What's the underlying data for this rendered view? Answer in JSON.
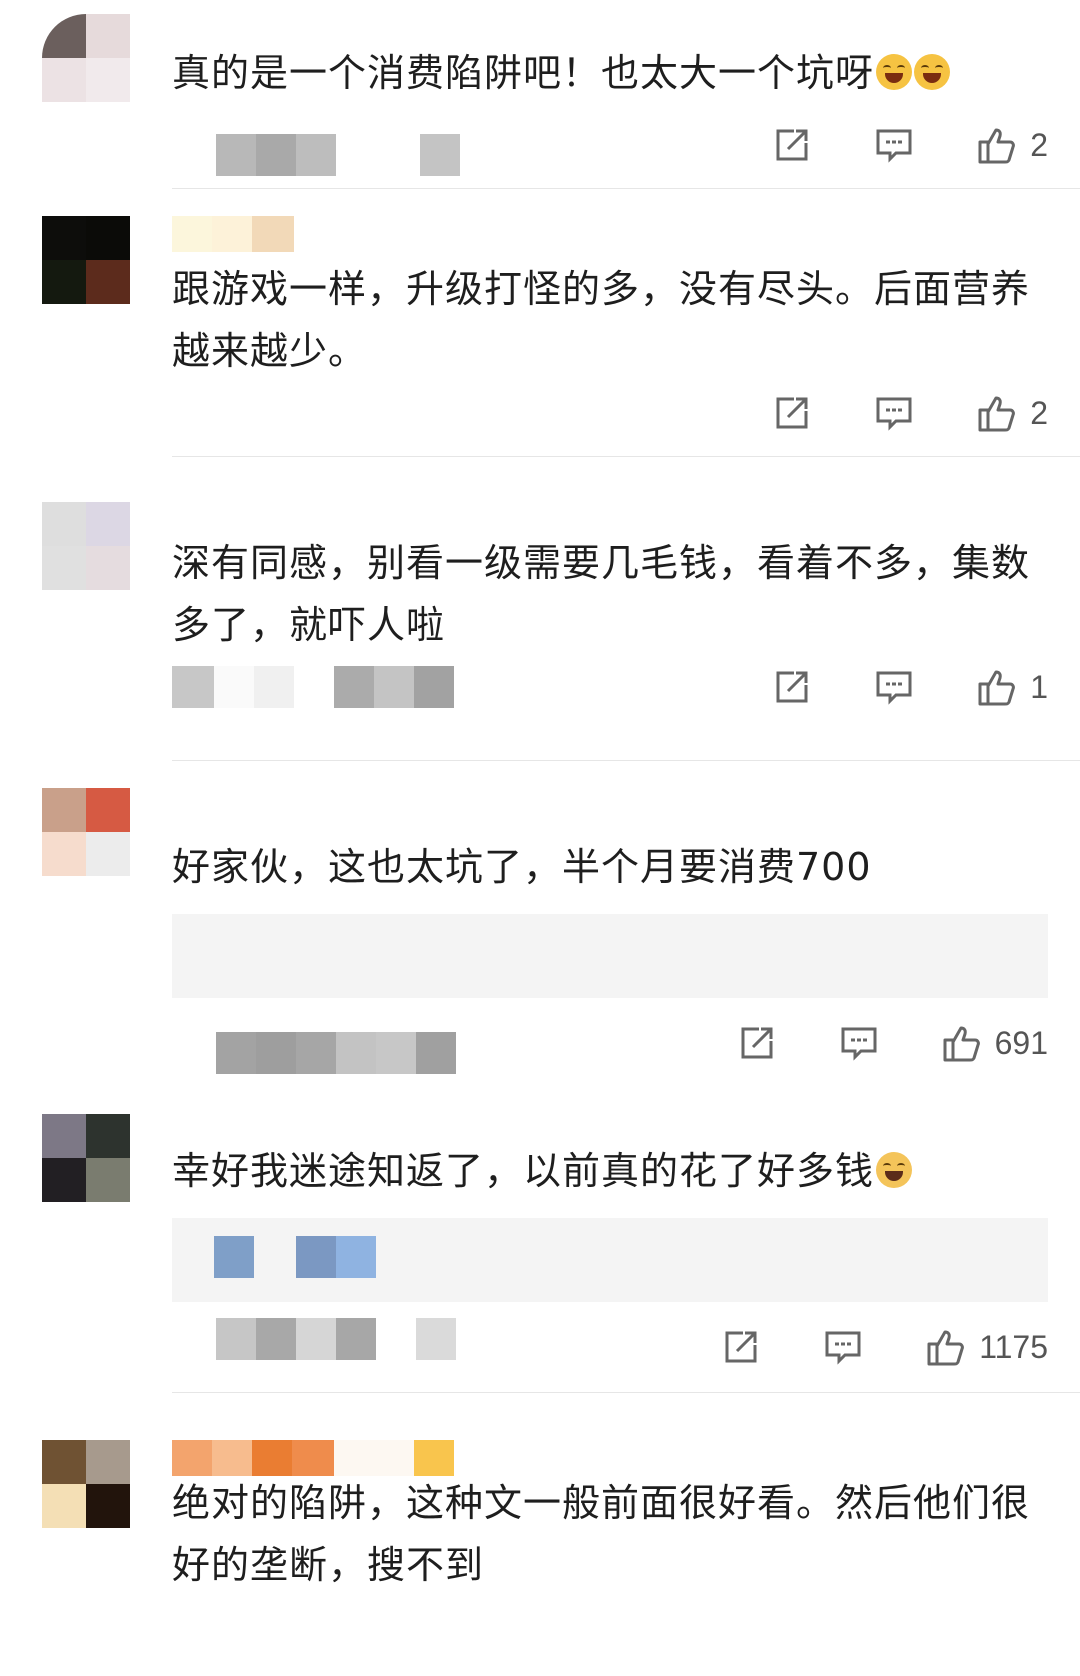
{
  "comments": [
    {
      "text": "真的是一个消费陷阱吧！也太大一个坑呀",
      "emoji": [
        "laugh-cry-emoji",
        "laugh-cry-emoji"
      ],
      "likes": "2"
    },
    {
      "text": "跟游戏一样，升级打怪的多，没有尽头。后面营养越来越少。",
      "likes": "2"
    },
    {
      "text": "深有同感，别看一级需要几毛钱，看着不多，集数多了，就吓人啦",
      "likes": "1"
    },
    {
      "text": "好家伙，这也太坑了，半个月要消费700",
      "likes": "691"
    },
    {
      "text": "幸好我迷途知返了，以前真的花了好多钱",
      "emoji": [
        "crying-emoji"
      ],
      "likes": "1175"
    },
    {
      "text": "绝对的陷阱，这种文一般前面很好看。然后他们很好的垄断，搜不到"
    }
  ],
  "icons": {
    "share": "share-icon",
    "comment": "comment-icon",
    "like": "thumbs-up-icon"
  },
  "colors": {
    "text": "#1e1e1e",
    "icon": "#555555",
    "divider": "#e6e6e6",
    "quote_bg": "#f4f4f4"
  }
}
